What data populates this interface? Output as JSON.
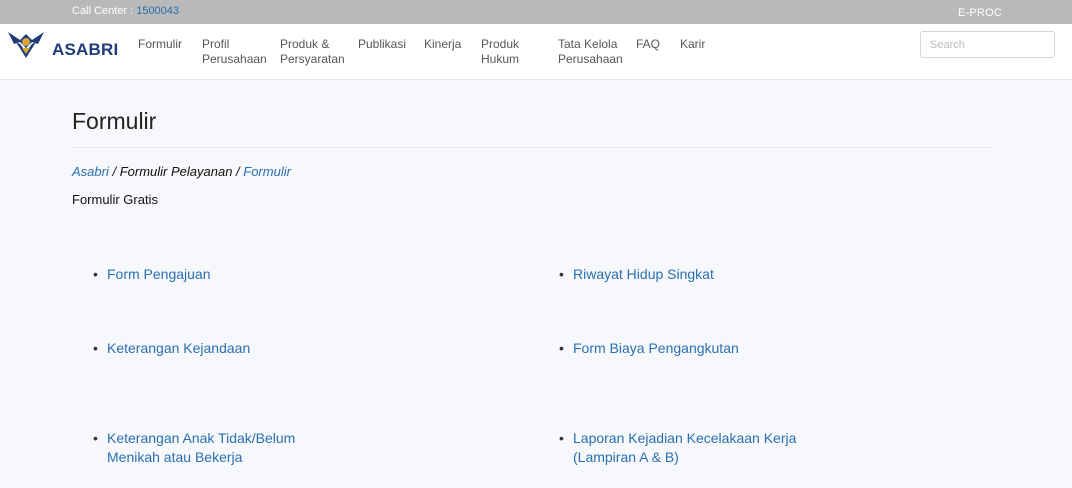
{
  "topbar": {
    "call_center_label": "Call Center :",
    "call_center_number": "1500043",
    "eproc": "E-PROC"
  },
  "brand": {
    "logo_text": "ASABRI"
  },
  "nav": {
    "formulir": "Formulir",
    "profil_line1": "Profil",
    "profil_line2": "Perusahaan",
    "produk_line1": "Produk &",
    "produk_line2": "Persyaratan",
    "publikasi": "Publikasi",
    "kinerja": "Kinerja",
    "hukum_line1": "Produk",
    "hukum_line2": "Hukum",
    "tata_line1": "Tata Kelola",
    "tata_line2": "Perusahaan",
    "faq": "FAQ",
    "karir": "Karir"
  },
  "search": {
    "placeholder": "Search",
    "value": ""
  },
  "page": {
    "title": "Formulir",
    "subtitle": "Formulir Gratis"
  },
  "breadcrumb": {
    "home": "Asabri",
    "sep1": " / ",
    "middle": "Formulir Pelayanan",
    "sep2": " / ",
    "current": "Formulir"
  },
  "forms": {
    "left": [
      {
        "line1": "Form Pengajuan",
        "line2": ""
      },
      {
        "line1": "Keterangan Kejandaan",
        "line2": ""
      },
      {
        "line1": "Keterangan Anak Tidak/Belum",
        "line2": "Menikah atau Bekerja"
      }
    ],
    "right": [
      {
        "line1": "Riwayat Hidup Singkat",
        "line2": ""
      },
      {
        "line1": "Form Biaya Pengangkutan",
        "line2": ""
      },
      {
        "line1": "Laporan Kejadian Kecelakaan Kerja",
        "line2": "(Lampiran A & B)"
      }
    ],
    "bullet": "•"
  },
  "colors": {
    "link": "#2a6fb0",
    "topbar": "#b9b9b9",
    "logo_navy": "#1f3c7a",
    "logo_gold": "#d8a53a"
  }
}
